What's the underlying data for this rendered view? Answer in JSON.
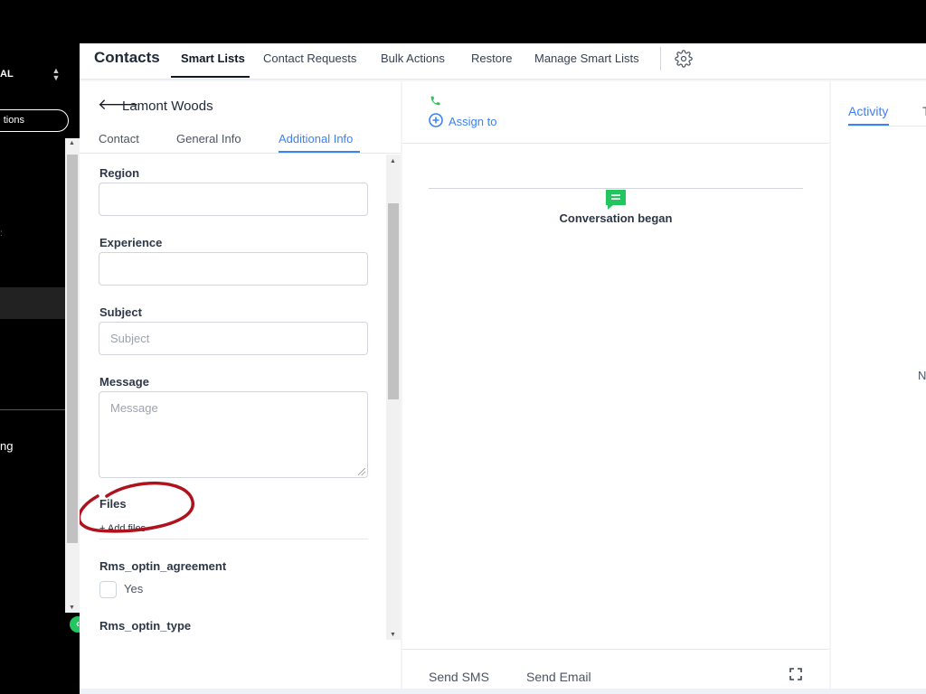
{
  "sidebar": {
    "location_label": "AL",
    "arrows": "⌃⌄",
    "pill_label": "tions",
    "bottom_label": "ng"
  },
  "topnav": {
    "title": "Contacts",
    "tabs": [
      {
        "label": "Smart Lists",
        "active": true
      },
      {
        "label": "Contact Requests",
        "active": false
      },
      {
        "label": "Bulk Actions",
        "active": false
      },
      {
        "label": "Restore",
        "active": false
      },
      {
        "label": "Manage Smart Lists",
        "active": false
      }
    ],
    "settings_icon": "gear-icon"
  },
  "contact": {
    "back_icon": "arrow-left-icon",
    "name": "Lamont Woods",
    "tabs": [
      {
        "label": "Contact",
        "active": false
      },
      {
        "label": "General Info",
        "active": false
      },
      {
        "label": "Additional Info",
        "active": true
      }
    ],
    "fields": {
      "region": {
        "label": "Region",
        "value": "",
        "placeholder": ""
      },
      "experience": {
        "label": "Experience",
        "value": "",
        "placeholder": ""
      },
      "subject": {
        "label": "Subject",
        "value": "",
        "placeholder": "Subject"
      },
      "message": {
        "label": "Message",
        "value": "",
        "placeholder": "Message"
      },
      "files": {
        "label": "Files",
        "add_label": "+ Add files"
      },
      "rms_optin_agreement": {
        "label": "Rms_optin_agreement",
        "option": "Yes",
        "checked": false
      },
      "rms_optin_type": {
        "label": "Rms_optin_type"
      }
    }
  },
  "conversation": {
    "phone_icon": "phone-icon",
    "assign_label": "Assign to",
    "event_text": "Conversation began",
    "accent_color": "#22c55e"
  },
  "composer": {
    "tabs": [
      "Send SMS",
      "Send Email"
    ],
    "expand_icon": "expand-icon"
  },
  "activity": {
    "tab_label": "Activity",
    "tab2_label": "T",
    "empty_text": "N"
  },
  "colors": {
    "primary": "#3b82f6",
    "success": "#22c55e",
    "annotation": "#b0121d"
  }
}
